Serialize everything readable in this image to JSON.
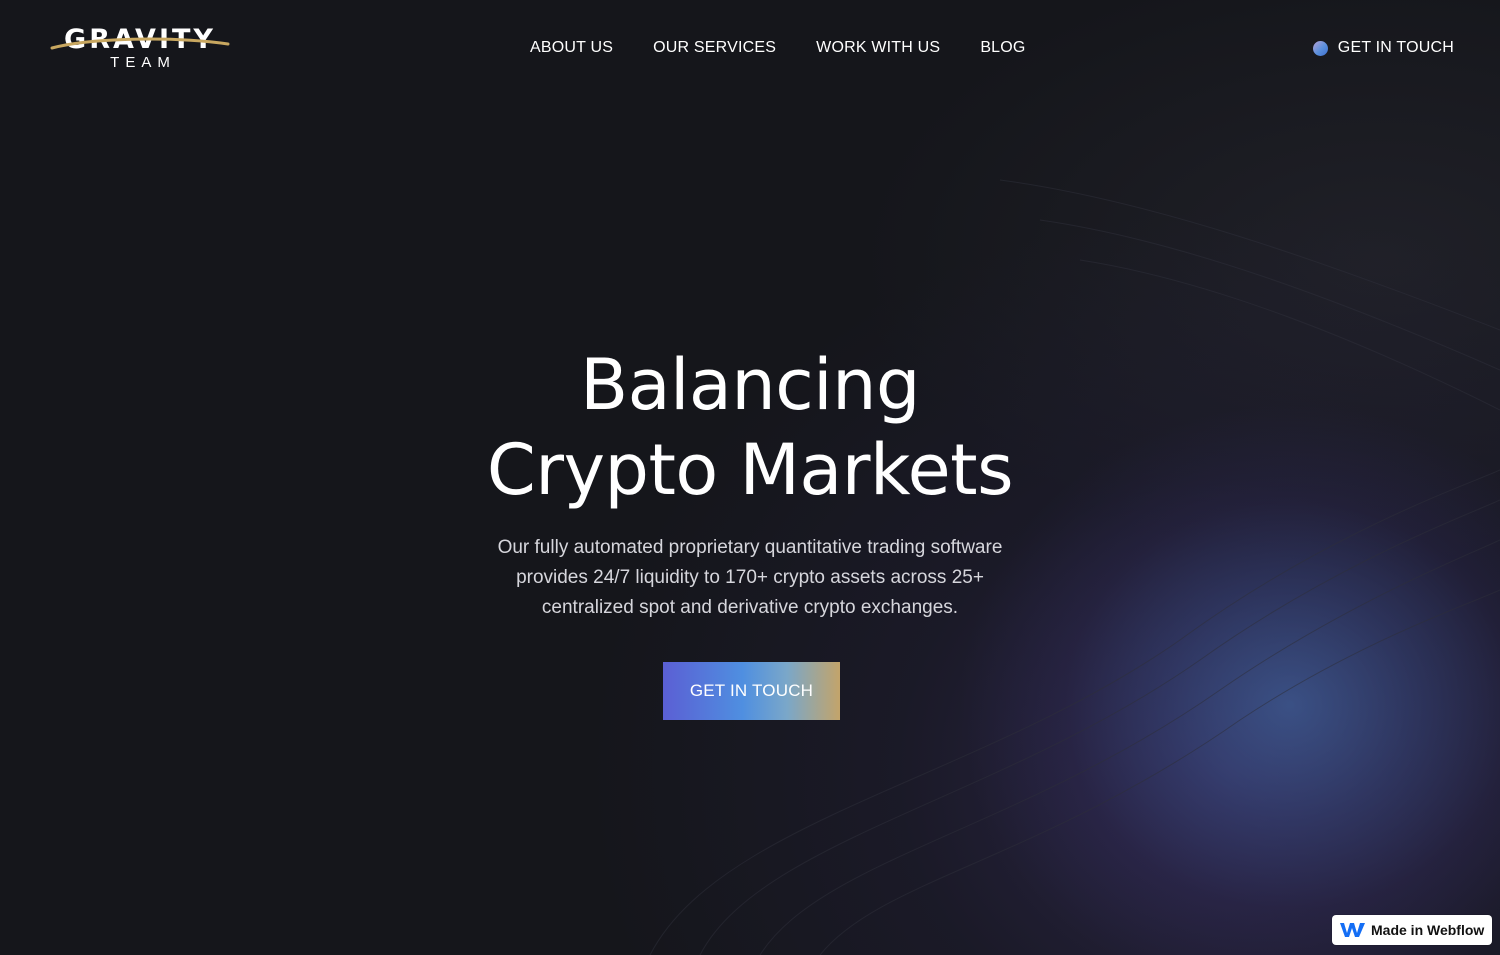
{
  "logo": {
    "word": "GRAVITY",
    "sub": "TEAM"
  },
  "nav": {
    "items": [
      {
        "label": "ABOUT US"
      },
      {
        "label": "OUR SERVICES"
      },
      {
        "label": "WORK WITH US"
      },
      {
        "label": "BLOG"
      }
    ]
  },
  "header_cta": {
    "label": "GET IN TOUCH"
  },
  "hero": {
    "title_line1": "Balancing",
    "title_line2": "Crypto Markets",
    "subtitle": "Our fully automated proprietary quantitative trading software provides 24/7 liquidity to 170+ crypto assets across 25+ centralized spot and derivative crypto exchanges.",
    "button_label": "GET IN TOUCH"
  },
  "badge": {
    "label": "Made in Webflow"
  },
  "colors": {
    "background": "#15161b",
    "text": "#ffffff",
    "subtitle": "#d6d6dc",
    "gold_accent": "#c8a760",
    "glow_blue": "#466cae",
    "button_gradient_start": "#5b5fd4",
    "button_gradient_end": "#c3a46a",
    "webflow_blue": "#146ef5"
  },
  "icons": {
    "cta_dot": "gradient-dot-icon",
    "logo_swoosh": "swoosh-icon",
    "webflow": "webflow-logo-icon"
  }
}
